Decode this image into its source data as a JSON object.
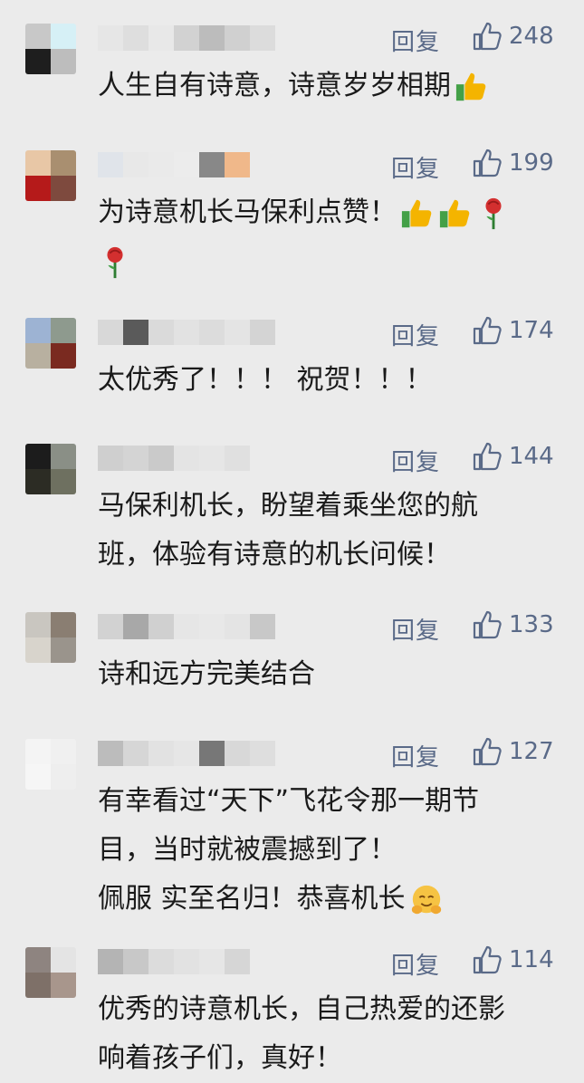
{
  "labels": {
    "reply": "回复"
  },
  "comments": [
    {
      "likes": "248",
      "lines": [
        "人生自有诗意，诗意岁岁相期"
      ]
    },
    {
      "likes": "199",
      "lines": [
        "为诗意机长马保利点赞！",
        ""
      ]
    },
    {
      "likes": "174",
      "lines": [
        "太优秀了！！！ 祝贺！！！"
      ]
    },
    {
      "likes": "144",
      "lines": [
        "马保利机长，盼望着乘坐您的航",
        "班，体验有诗意的机长问候！"
      ]
    },
    {
      "likes": "133",
      "lines": [
        "诗和远方完美结合"
      ]
    },
    {
      "likes": "127",
      "lines": [
        "有幸看过“天下”飞花令那一期节",
        "目，当时就被震撼到了！",
        "佩服 实至名归！恭喜机长"
      ]
    },
    {
      "likes": "114",
      "lines": [
        "优秀的诗意机长，自己热爱的还影",
        "响着孩子们，真好！"
      ]
    }
  ],
  "icons": {
    "like": "thumbs-up-outline-icon",
    "thumbs": "thumbs-up-emoji",
    "rose": "rose-emoji",
    "hug": "hugging-face-emoji"
  }
}
